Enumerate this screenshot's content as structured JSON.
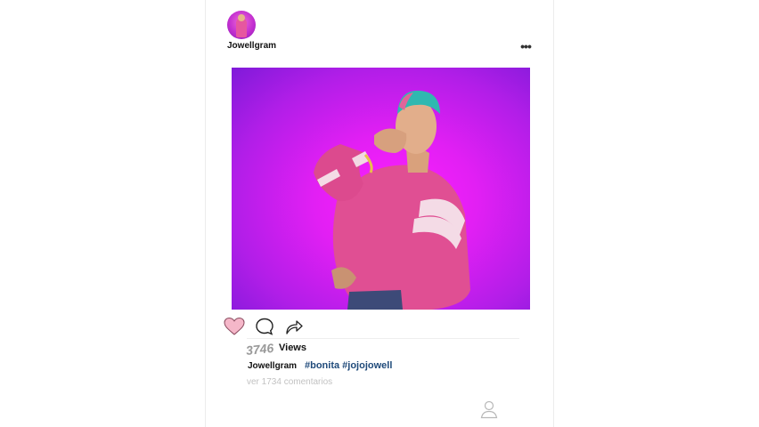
{
  "post": {
    "username": "Jowellgram",
    "more_icon": "more-horizontal-icon",
    "more_glyph": "•••",
    "photo_icon": "post-photo",
    "background_colors": [
      "#ff1fff",
      "#b21ee8",
      "#7f1ad9"
    ]
  },
  "actions": {
    "like_icon": "heart-icon",
    "comment_icon": "comment-bubble-icon",
    "share_icon": "share-arrow-icon",
    "heart_color": "#f5b7c9"
  },
  "stats": {
    "views_count": "3746",
    "views_label": "Views"
  },
  "caption": {
    "username": "Jowellgram",
    "hashtags": "#bonita #jojojowell"
  },
  "comments": {
    "link_text": "ver 1734 comentarios"
  },
  "footer": {
    "profile_icon": "user-profile-icon"
  }
}
